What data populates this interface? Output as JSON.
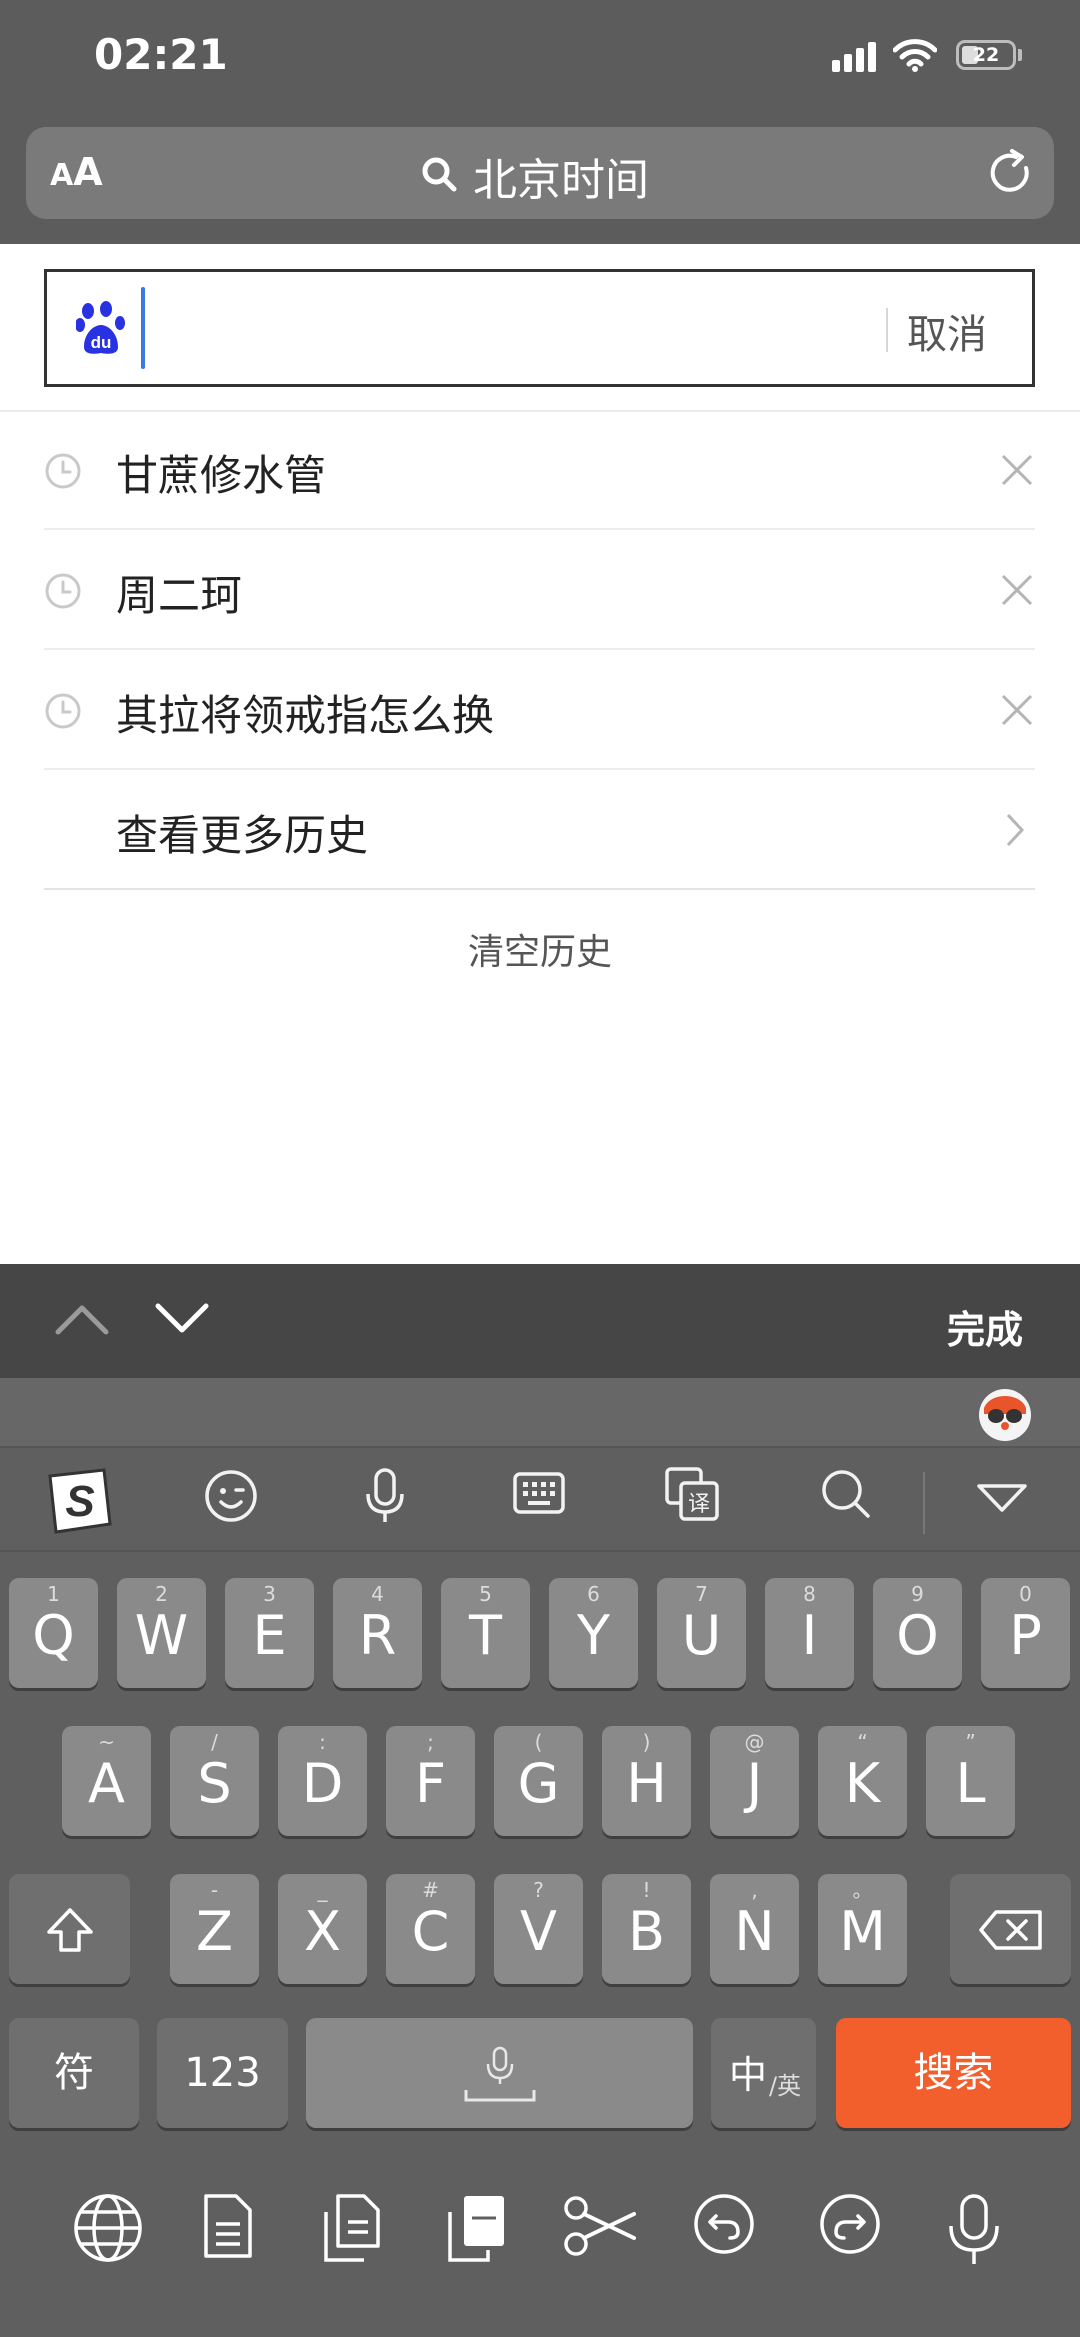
{
  "status_bar": {
    "time": "02:21",
    "battery": "22"
  },
  "url_bar": {
    "aa_small": "A",
    "aa_big": "A",
    "url_text": "北京时间"
  },
  "search": {
    "placeholder": "",
    "value": "",
    "cancel_label": "取消"
  },
  "history": [
    {
      "label": "甘蔗修水管"
    },
    {
      "label": "周二珂"
    },
    {
      "label": "其拉将领戒指怎么换"
    }
  ],
  "more_history_label": "查看更多历史",
  "clear_history_label": "清空历史",
  "accessory": {
    "done_label": "完成"
  },
  "keyboard": {
    "row1": [
      {
        "hint": "1",
        "key": "Q"
      },
      {
        "hint": "2",
        "key": "W"
      },
      {
        "hint": "3",
        "key": "E"
      },
      {
        "hint": "4",
        "key": "R"
      },
      {
        "hint": "5",
        "key": "T"
      },
      {
        "hint": "6",
        "key": "Y"
      },
      {
        "hint": "7",
        "key": "U"
      },
      {
        "hint": "8",
        "key": "I"
      },
      {
        "hint": "9",
        "key": "O"
      },
      {
        "hint": "0",
        "key": "P"
      }
    ],
    "row2": [
      {
        "hint": "~",
        "key": "A"
      },
      {
        "hint": "/",
        "key": "S"
      },
      {
        "hint": ":",
        "key": "D"
      },
      {
        "hint": ";",
        "key": "F"
      },
      {
        "hint": "(",
        "key": "G"
      },
      {
        "hint": ")",
        "key": "H"
      },
      {
        "hint": "@",
        "key": "J"
      },
      {
        "hint": "“",
        "key": "K"
      },
      {
        "hint": "”",
        "key": "L"
      }
    ],
    "row3": [
      {
        "hint": "-",
        "key": "Z"
      },
      {
        "hint": "_",
        "key": "X"
      },
      {
        "hint": "#",
        "key": "C"
      },
      {
        "hint": "?",
        "key": "V"
      },
      {
        "hint": "!",
        "key": "B"
      },
      {
        "hint": ",",
        "key": "N"
      },
      {
        "hint": "。",
        "key": "M"
      }
    ],
    "symbols_label": "符",
    "numbers_label": "123",
    "lang_main": "中",
    "lang_sub": "/英",
    "search_label": "搜索"
  },
  "colors": {
    "accent_orange": "#f25f2c",
    "caret_blue": "#3a7ae8",
    "baidu_blue": "#2932e1"
  }
}
